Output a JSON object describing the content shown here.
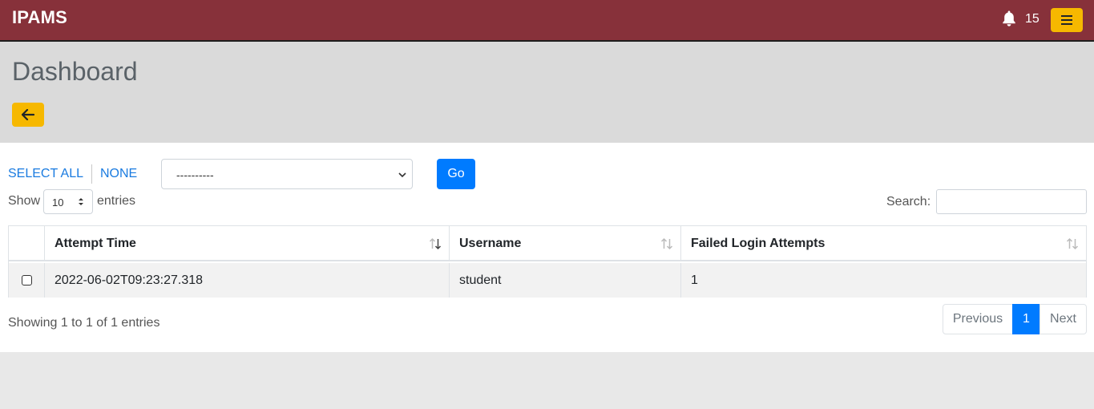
{
  "app": {
    "brand": "IPAMS",
    "notification_count": "15"
  },
  "icons": {
    "notifications": "bell-icon",
    "menu": "hamburger-menu-icon",
    "back": "arrow-left-icon"
  },
  "colors": {
    "topbar": "#87313a",
    "accent": "#f6b800",
    "primary": "#007bff",
    "link": "#1a7be0"
  },
  "page": {
    "title": "Dashboard"
  },
  "bulk_actions": {
    "select_all": "SELECT ALL",
    "none": "NONE",
    "action_value": "----------",
    "go_label": "Go"
  },
  "table_controls": {
    "show_label": "Show",
    "page_length": "10",
    "entries_label": "entries",
    "search_label": "Search:",
    "search_value": ""
  },
  "table": {
    "columns": [
      {
        "label": ""
      },
      {
        "label": "Attempt Time"
      },
      {
        "label": "Username"
      },
      {
        "label": "Failed Login Attempts"
      }
    ],
    "rows": [
      {
        "checked": false,
        "attempt_time": "2022-06-02T09:23:27.318",
        "username": "student",
        "failed_attempts": "1"
      }
    ]
  },
  "footer": {
    "info": "Showing 1 to 1 of 1 entries",
    "previous": "Previous",
    "current_page": "1",
    "next": "Next"
  }
}
